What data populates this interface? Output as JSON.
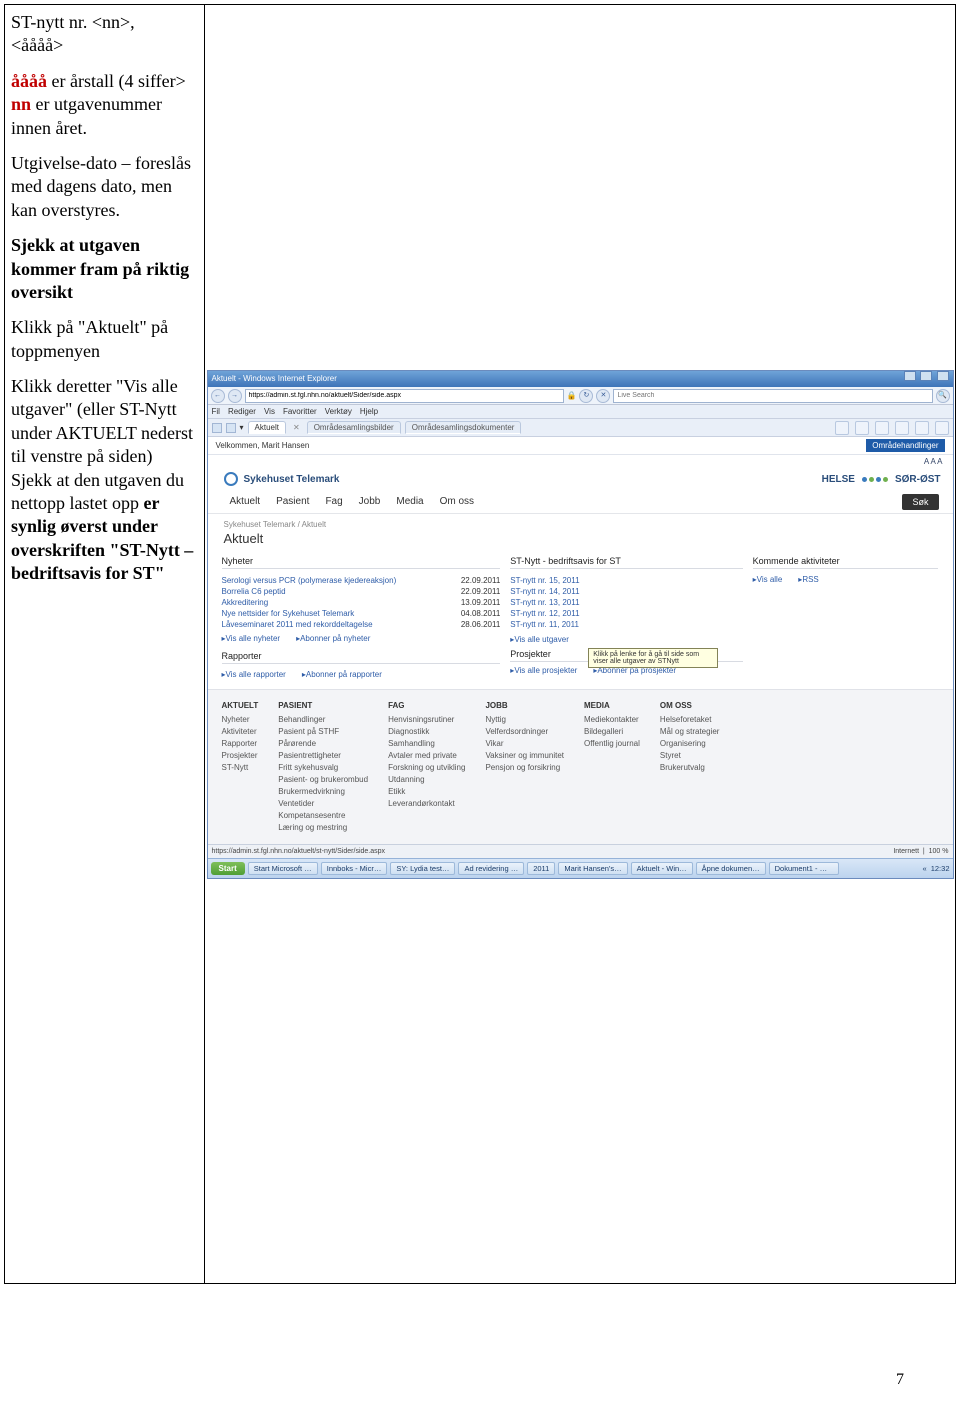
{
  "pagenum": "7",
  "left": {
    "line1": "ST-nytt nr. <nn>,",
    "line2": "<åååå>",
    "l3a": "åååå",
    "l3b": " er årstall (4 siffer>",
    "l4a": "nn",
    "l4b": " er utgavenummer innen året.",
    "l5": "Utgivelse-dato – foreslås med dagens dato, men kan overstyres.",
    "l6": "Sjekk at utgaven kommer fram på riktig oversikt",
    "l7": "Klikk på \"Aktuelt\" på toppmenyen",
    "l8": "Klikk deretter \"Vis alle utgaver\" (eller ST-Nytt under AKTUELT nederst til venstre på siden)",
    "l9a": "Sjekk at den utgaven du nettopp lastet opp ",
    "l9b": "er synlig øverst under overskriften \"ST-Nytt – bedriftsavis for ST\""
  },
  "shot": {
    "title": "Aktuelt - Windows Internet Explorer",
    "url": "https://admin.st.fgl.nhn.no/aktuelt/Sider/side.aspx",
    "search_placeholder": "Live Search",
    "menu": [
      "Fil",
      "Rediger",
      "Vis",
      "Favoritter",
      "Verktøy",
      "Hjelp"
    ],
    "tabs": {
      "t1": "Aktuelt",
      "t2": "Områdesamlingsbilder",
      "t3": "Områdesamlingsdokumenter"
    },
    "welcome": "Velkommen, Marit Hansen",
    "blueband": "Områdehandlinger",
    "aaa": "A A A",
    "brand_left": "Sykehuset Telemark",
    "brand_right": "HELSE ●● SØR-ØST",
    "mainnav": [
      "Aktuelt",
      "Pasient",
      "Fag",
      "Jobb",
      "Media",
      "Om oss"
    ],
    "sok": "Søk",
    "crumb": "Sykehuset Telemark / Aktuelt",
    "pagetitle": "Aktuelt",
    "cols": {
      "nyheter": {
        "h": "Nyheter",
        "items": [
          {
            "t": "Serologi versus PCR (polymerase kjedereaksjon)",
            "d": "22.09.2011"
          },
          {
            "t": "Borrelia C6 peptid",
            "d": "22.09.2011"
          },
          {
            "t": "Akkreditering",
            "d": "13.09.2011"
          },
          {
            "t": "Nye nettsider for Sykehuset Telemark",
            "d": "04.08.2011"
          },
          {
            "t": "Låveseminaret 2011 med rekorddeltagelse",
            "d": "28.06.2011"
          }
        ],
        "links": [
          "▸Vis alle nyheter",
          "▸Abonner på nyheter"
        ],
        "rap_h": "Rapporter",
        "rap_link": "▸Vis alle rapporter",
        "rap_link2": "▸Abonner på rapporter"
      },
      "stnytt": {
        "h": "ST-Nytt - bedriftsavis for ST",
        "items": [
          "ST-nytt nr. 15, 2011",
          "ST-nytt nr. 14, 2011",
          "ST-nytt nr. 13, 2011",
          "ST-nytt nr. 12, 2011",
          "ST-nytt nr. 11, 2011"
        ],
        "link": "▸Vis alle utgaver",
        "proj_h": "Prosjekter",
        "tooltip": "Klikk på lenke for å gå til side som viser alle utgaver av STNytt",
        "proj_l1": "▸Vis alle prosjekter",
        "proj_l2": "▸Abonner på prosjekter"
      },
      "komm": {
        "h": "Kommende aktiviteter",
        "link1": "▸Vis alle",
        "link2": "▸RSS"
      }
    },
    "footer": {
      "c1h": "AKTUELT",
      "c1": [
        "Nyheter",
        "Aktiviteter",
        "Rapporter",
        "Prosjekter",
        "ST-Nytt"
      ],
      "c2h": "PASIENT",
      "c2": [
        "Behandlinger",
        "Pasient på STHF",
        "Pårørende",
        "Pasientrettigheter",
        "Fritt sykehusvalg",
        "Pasient- og brukerombud",
        "Brukermedvirkning",
        "Ventetider",
        "Kompetansesentre",
        "Læring og mestring"
      ],
      "c3h": "FAG",
      "c3": [
        "Henvisningsrutiner",
        "Diagnostikk",
        "Samhandling",
        "Avtaler med private",
        "Forskning og utvikling",
        "Utdanning",
        "Etikk",
        "Leverandørkontakt"
      ],
      "c4h": "JOBB",
      "c4": [
        "Nyttig",
        "Velferdsordninger",
        "Vikar",
        "Vaksiner og immunitet",
        "Pensjon og forsikring"
      ],
      "c5h": "MEDIA",
      "c5": [
        "Mediekontakter",
        "Bildegalleri",
        "Offentlig journal"
      ],
      "c6h": "OM OSS",
      "c6": [
        "Helseforetaket",
        "Mål og strategier",
        "Organisering",
        "Styret",
        "Brukerutvalg"
      ]
    },
    "status": {
      "url": "https://admin.st.fgl.nhn.no/aktuelt/st-nytt/Sider/side.aspx",
      "zone": "Internett",
      "zoom": "100 %"
    },
    "task": {
      "start": "Start",
      "items": [
        "Start Microsoft Offic…",
        "Innboks - Micr…",
        "SY: Lydia test…",
        "Ad revidering …",
        "2011",
        "Marit Hansen's…",
        "Aktuelt - Win…",
        "Åpne dokumen…",
        "Dokument1 - M…"
      ],
      "clock": "12:32"
    }
  }
}
